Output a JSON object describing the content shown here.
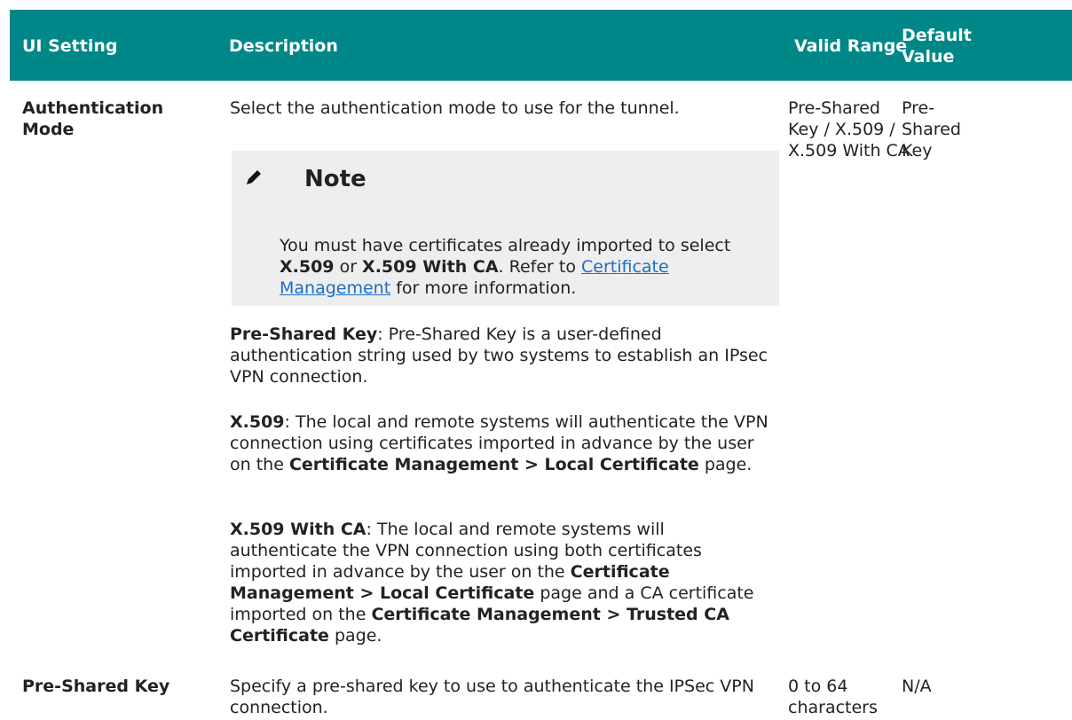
{
  "header": {
    "ui_setting": "UI Setting",
    "description": "Description",
    "valid_range": "Valid Range",
    "default_value_line1": "Default",
    "default_value_line2": "Value"
  },
  "rows": [
    {
      "setting": "Authentication Mode",
      "description": "Select the authentication mode to use for the tunnel.",
      "valid_range": "Pre-Shared Key / X.509 / X.509 With CA",
      "default_value": "Pre-Shared Key",
      "note": {
        "icon": "pencil-icon",
        "title": "Note",
        "text_1": "You must have certificates already imported to select ",
        "bold_1": "X.509",
        "text_2": " or ",
        "bold_2": "X.509 With CA",
        "text_3": ". Refer to ",
        "link": "Certificate Management",
        "text_4": " for more information."
      },
      "paragraphs": [
        {
          "term": "Pre-Shared Key",
          "text": ": Pre-Shared Key is a user-defined authentication string used by two systems to establish an IPsec VPN connection."
        },
        {
          "term": "X.509",
          "text_1": ": The local and remote systems will authenticate the VPN connection using certificates imported in advance by the user on the ",
          "bold_1": "Certificate Management > Local Certificate",
          "text_2": " page."
        },
        {
          "term": "X.509 With CA",
          "text_1": ": The local and remote systems will authenticate the VPN connection using both certificates imported in advance by the user on the ",
          "bold_1": "Certificate Management > Local Certificate",
          "text_2": " page and a CA certificate imported on the ",
          "bold_2": "Certificate Management > Trusted CA Certificate",
          "text_3": " page."
        }
      ]
    },
    {
      "setting": "Pre-Shared Key",
      "description": "Specify a pre-shared key to use to authenticate the IPSec VPN connection.",
      "valid_range": "0 to 64 characters",
      "default_value": "N/A"
    }
  ],
  "colors": {
    "header_bg": "#008787",
    "note_bg": "#eeeeee",
    "link": "#1a6fc2"
  }
}
